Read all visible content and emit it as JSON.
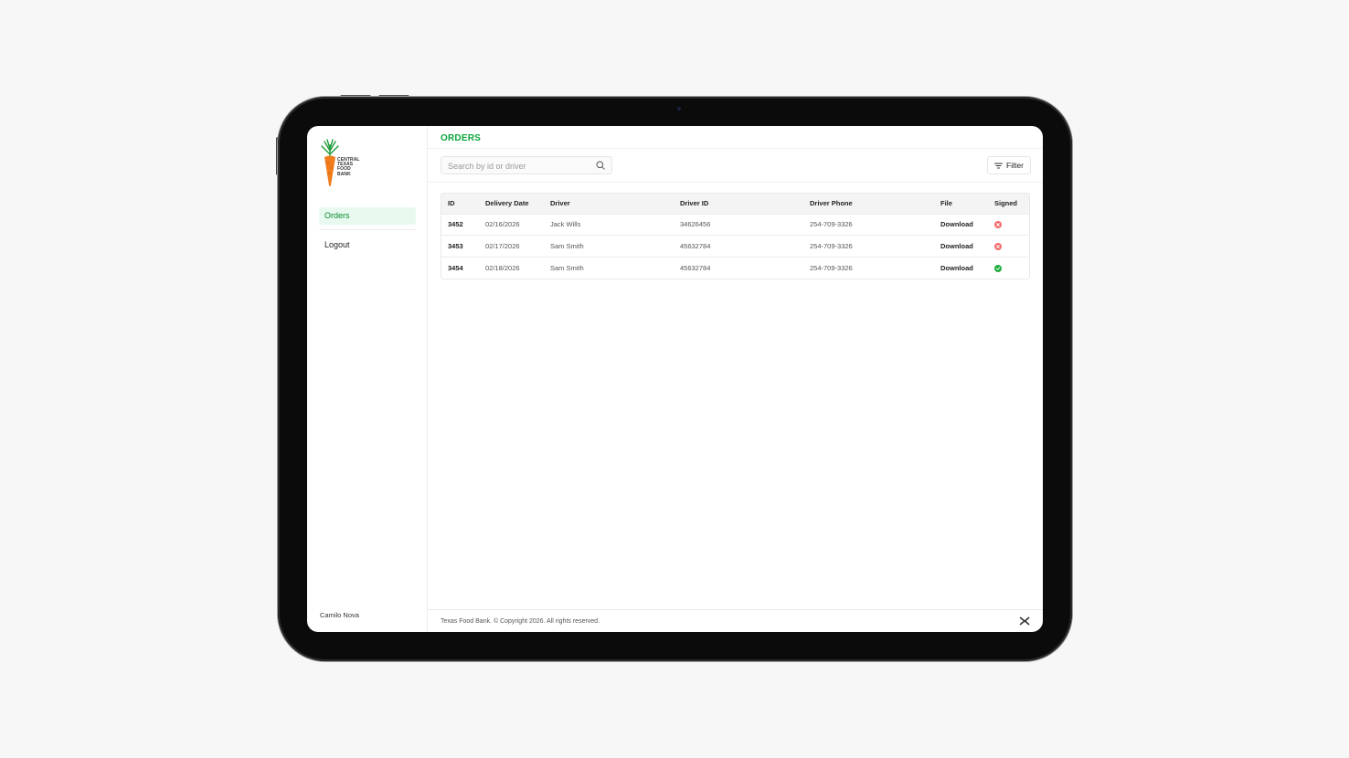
{
  "brand": {
    "logo_lines": [
      "CENTRAL",
      "TEXAS",
      "FOOD",
      "BANK"
    ],
    "carrot_color": "#f07c1b",
    "leaf_color": "#1e9c3a",
    "accent": "#0aa53a"
  },
  "sidebar": {
    "items": [
      {
        "label": "Orders",
        "active": true
      },
      {
        "label": "Logout",
        "active": false
      }
    ],
    "user_name": "Camilo Nova"
  },
  "header": {
    "title": "ORDERS"
  },
  "toolbar": {
    "search_placeholder": "Search by id or driver",
    "filter_label": "Filter"
  },
  "table": {
    "columns": [
      "ID",
      "Delivery Date",
      "Driver",
      "Driver ID",
      "Driver Phone",
      "File",
      "Signed"
    ],
    "rows": [
      {
        "id": "3452",
        "date": "02/16/2026",
        "driver": "Jack Wills",
        "driver_id": "34626456",
        "phone": "254-709-3326",
        "file": "Download",
        "signed": false
      },
      {
        "id": "3453",
        "date": "02/17/2026",
        "driver": "Sam Smith",
        "driver_id": "45632784",
        "phone": "254-709-3326",
        "file": "Download",
        "signed": false
      },
      {
        "id": "3454",
        "date": "02/18/2026",
        "driver": "Sam Smith",
        "driver_id": "45632784",
        "phone": "254-709-3326",
        "file": "Download",
        "signed": true
      }
    ],
    "status_colors": {
      "unsigned": "#f26b6b",
      "signed": "#1fae3f"
    }
  },
  "footer": {
    "text": "Texas Food Bank. © Copyright 2026. All rights reserved."
  }
}
